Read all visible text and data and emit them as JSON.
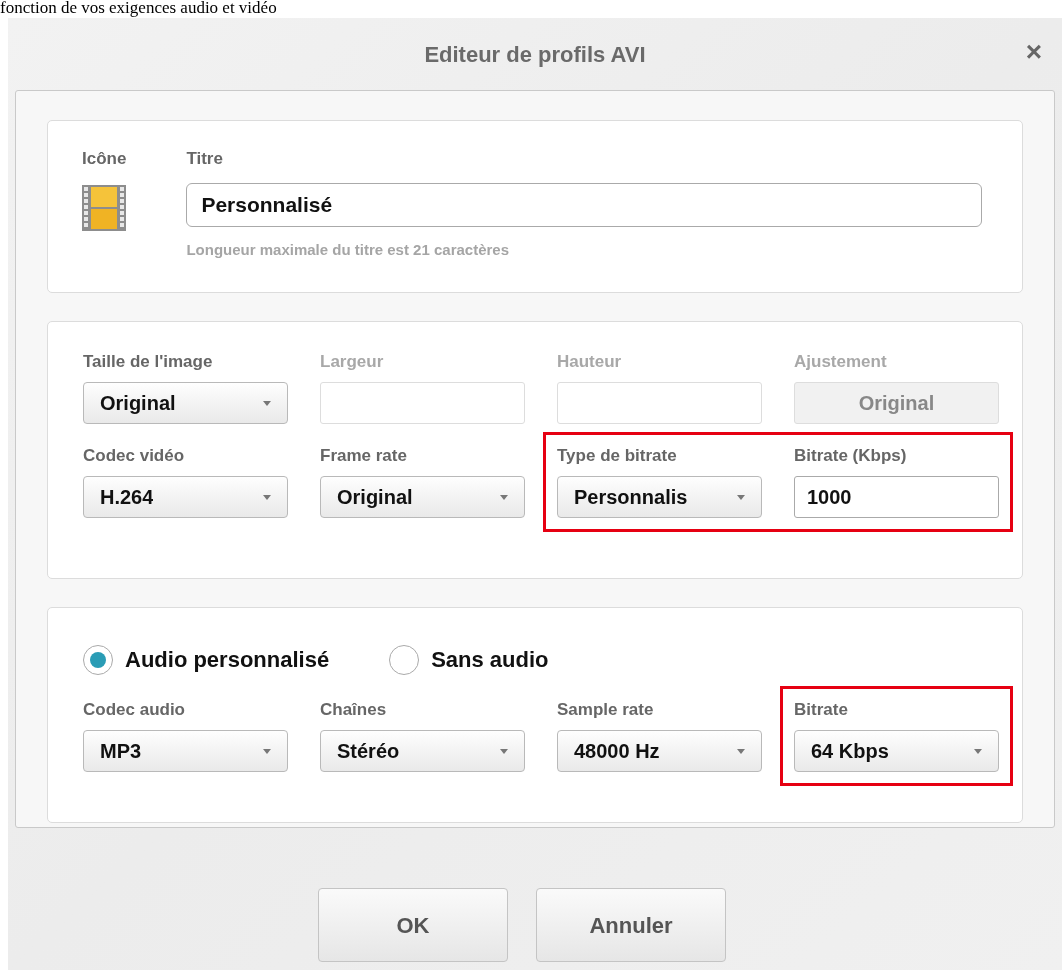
{
  "page_text": "fonction de vos exigences audio et vidéo",
  "dialog": {
    "title": "Editeur de profils AVI",
    "close": "×"
  },
  "title_section": {
    "icon_label": "Icône",
    "title_label": "Titre",
    "title_value": "Personnalisé",
    "hint": "Longueur maximale du titre est 21 caractères"
  },
  "video_rows": [
    [
      {
        "highlighted": false,
        "fields": [
          {
            "kind": "dropdown",
            "label": "Taille de l'image",
            "value": "Original",
            "disabled": false
          },
          {
            "kind": "text",
            "label": "Largeur",
            "disabled": true
          },
          {
            "kind": "text",
            "label": "Hauteur",
            "disabled": true
          },
          {
            "kind": "button",
            "label": "Ajustement",
            "value": "Original",
            "disabled": true
          }
        ]
      }
    ],
    [
      {
        "highlighted": false,
        "fields": [
          {
            "kind": "dropdown",
            "label": "Codec vidéo",
            "value": "H.264",
            "disabled": false
          },
          {
            "kind": "dropdown",
            "label": "Frame rate",
            "value": "Original",
            "disabled": false
          }
        ]
      },
      {
        "highlighted": true,
        "fields": [
          {
            "kind": "dropdown",
            "label": "Type de bitrate",
            "value": "Personnalis",
            "disabled": false
          },
          {
            "kind": "text",
            "label": "Bitrate (Kbps)",
            "value": "1000",
            "disabled": false
          }
        ]
      }
    ]
  ],
  "audio_options": [
    {
      "label": "Audio personnalisé",
      "selected": true
    },
    {
      "label": "Sans audio",
      "selected": false
    }
  ],
  "audio_row": [
    {
      "highlighted": false,
      "fields": [
        {
          "kind": "dropdown",
          "label": "Codec audio",
          "value": "MP3",
          "disabled": false
        },
        {
          "kind": "dropdown",
          "label": "Chaînes",
          "value": "Stéréo",
          "disabled": false
        },
        {
          "kind": "dropdown",
          "label": "Sample rate",
          "value": "48000 Hz",
          "disabled": false
        }
      ]
    },
    {
      "highlighted": true,
      "fields": [
        {
          "kind": "dropdown",
          "label": "Bitrate",
          "value": "64 Kbps",
          "disabled": false
        }
      ]
    }
  ],
  "buttons": [
    "OK",
    "Annuler"
  ]
}
